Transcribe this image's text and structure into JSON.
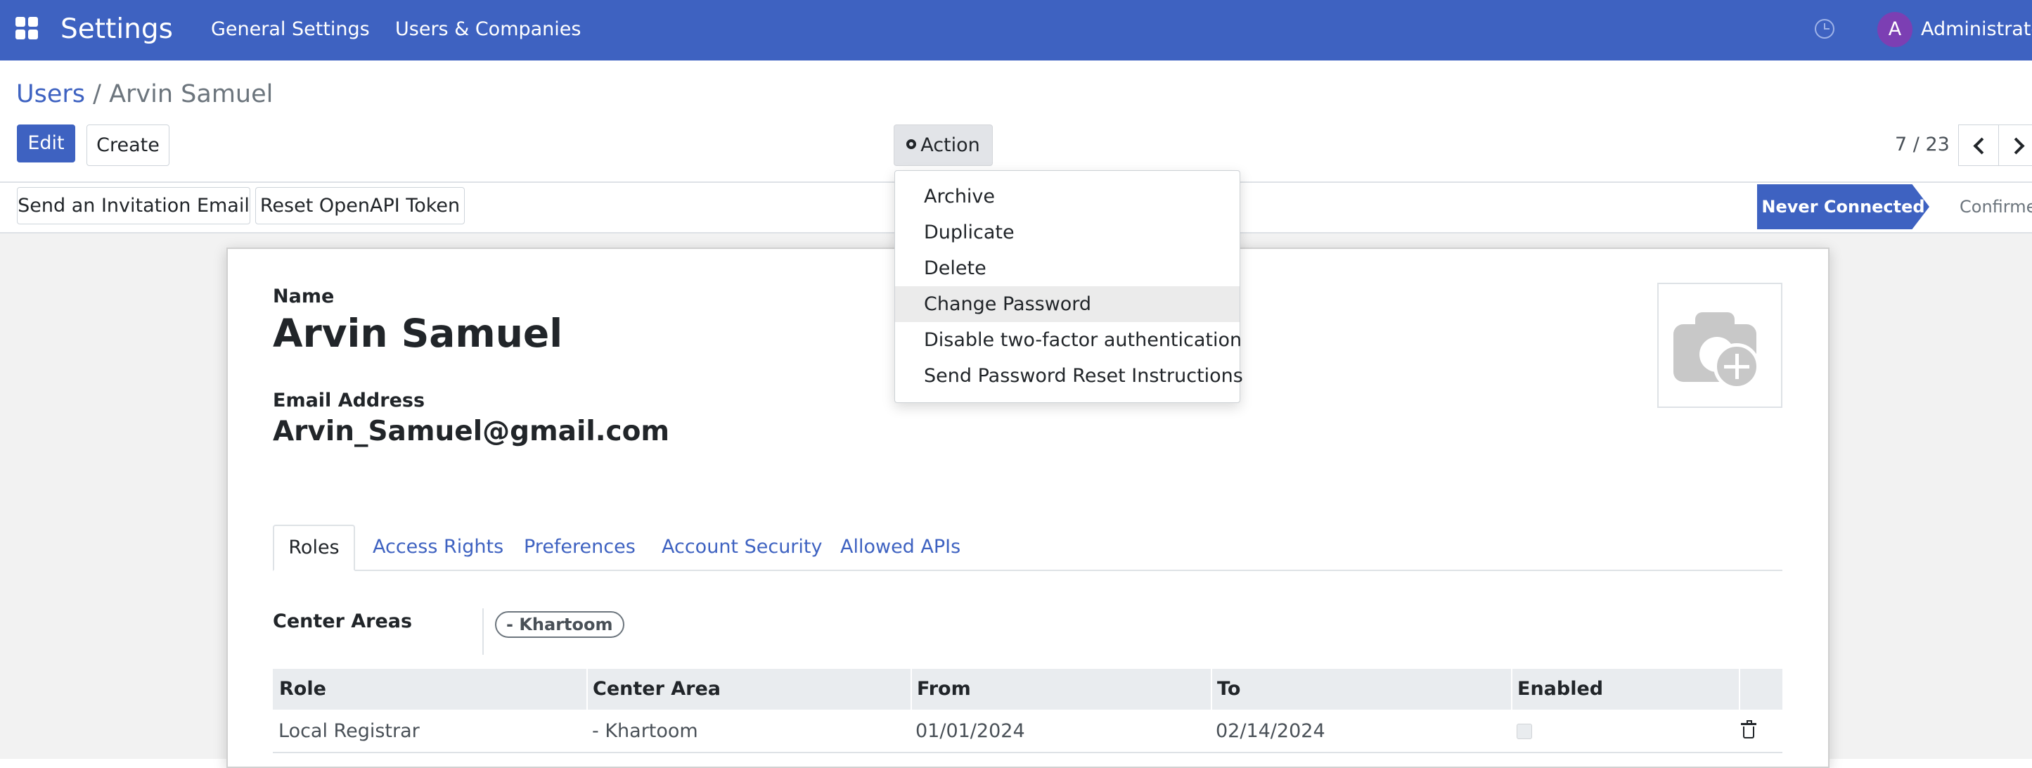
{
  "navbar": {
    "app_title": "Settings",
    "links": [
      "General Settings",
      "Users & Companies"
    ],
    "user_initial": "A",
    "user_name": "Administrator"
  },
  "breadcrumb": {
    "parent": "Users",
    "separator": "/",
    "current": "Arvin Samuel"
  },
  "toolbar": {
    "edit_label": "Edit",
    "create_label": "Create",
    "action_label": "Action"
  },
  "pager": {
    "value": "7 / 23"
  },
  "statusbar": {
    "buttons": [
      "Send an Invitation Email",
      "Reset OpenAPI Token"
    ],
    "stages": [
      "Never Connected",
      "Confirmed"
    ],
    "active_stage": "Never Connected"
  },
  "action_menu": {
    "items": [
      "Archive",
      "Duplicate",
      "Delete",
      "Change Password",
      "Disable two-factor authentication",
      "Send Password Reset Instructions"
    ],
    "highlighted": "Change Password"
  },
  "form": {
    "name_label": "Name",
    "name_value": "Arvin Samuel",
    "email_label": "Email Address",
    "email_value": "Arvin_Samuel@gmail.com",
    "tabs": [
      "Roles",
      "Access Rights",
      "Preferences",
      "Account Security",
      "Allowed APIs"
    ],
    "active_tab": "Roles",
    "center_areas_label": "Center Areas",
    "center_areas_tags": [
      "- Khartoom"
    ],
    "roles_table": {
      "columns": [
        "Role",
        "Center Area",
        "From",
        "To",
        "Enabled"
      ],
      "rows": [
        {
          "role": "Local Registrar",
          "center_area": "- Khartoom",
          "from": "01/01/2024",
          "to": "02/14/2024",
          "enabled": false
        }
      ]
    }
  },
  "icons": {
    "apps": "apps-grid-icon",
    "clock": "clock-icon",
    "gear": "gear-icon",
    "prev": "chevron-left-icon",
    "next": "chevron-right-icon",
    "photo": "camera-plus-icon",
    "delete": "trash-icon"
  },
  "colors": {
    "brand": "#3e62c1",
    "avatar": "#7c3fb3"
  }
}
